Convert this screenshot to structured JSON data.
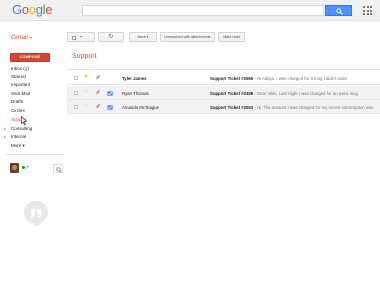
{
  "header": {
    "logo_letters": [
      {
        "char": "G",
        "color": "#4285f4"
      },
      {
        "char": "o",
        "color": "#ea4335"
      },
      {
        "char": "o",
        "color": "#fbbc05"
      },
      {
        "char": "g",
        "color": "#4285f4"
      },
      {
        "char": "l",
        "color": "#34a853"
      },
      {
        "char": "e",
        "color": "#ea4335"
      }
    ],
    "search_value": "",
    "search_icon": "magnifier-icon",
    "apps_icon": "apps-grid-icon"
  },
  "toolbar": {
    "app_label": "Gmail",
    "app_caret": "▾",
    "refresh_glyph": "↻",
    "more_label": "More ▾",
    "unread_label": "Unresolved with attachments",
    "mark_read_label": "Mark read"
  },
  "nav": {
    "compose_label": "COMPOSE",
    "items": [
      {
        "id": "inbox",
        "label": "Inbox (1)"
      },
      {
        "id": "starred",
        "label": "Starred"
      },
      {
        "id": "important",
        "label": "Important"
      },
      {
        "id": "sent",
        "label": "Sent Mail"
      },
      {
        "id": "drafts",
        "label": "Drafts"
      },
      {
        "id": "circles",
        "label": "Circles"
      },
      {
        "id": "support",
        "label": "Support"
      },
      {
        "id": "consulting",
        "label": "Consulting"
      },
      {
        "id": "internal",
        "label": "Internal"
      },
      {
        "id": "more",
        "label": "More ▾"
      }
    ],
    "chat_caret": "▾",
    "colors": {
      "accent": "#dd4b39",
      "compose": "#d14836"
    }
  },
  "main": {
    "folder_title": "Support",
    "emails": [
      {
        "sender": "Tyler James",
        "subject": "Support Ticket #2565",
        "snippet": " - Hi Aditya, I was charged for a mug I didn't order",
        "starred": true,
        "unread": true,
        "status_icon": "none"
      },
      {
        "sender": "Ryan Thomas",
        "subject": "Support Ticket #2498",
        "snippet": " - Dear Vikki, Last night I was charged for an extra mug",
        "starred": false,
        "unread": false,
        "status_icon": "resolved-icon"
      },
      {
        "sender": "Amanda McTeague",
        "subject": "Support Ticket #2553",
        "snippet": " - Hi, The amount I was charged for my recent subscription was",
        "starred": false,
        "unread": false,
        "status_icon": "resolved-icon"
      }
    ],
    "colors": {
      "star": "#f7cb4d",
      "status": "#4d90fe"
    }
  }
}
